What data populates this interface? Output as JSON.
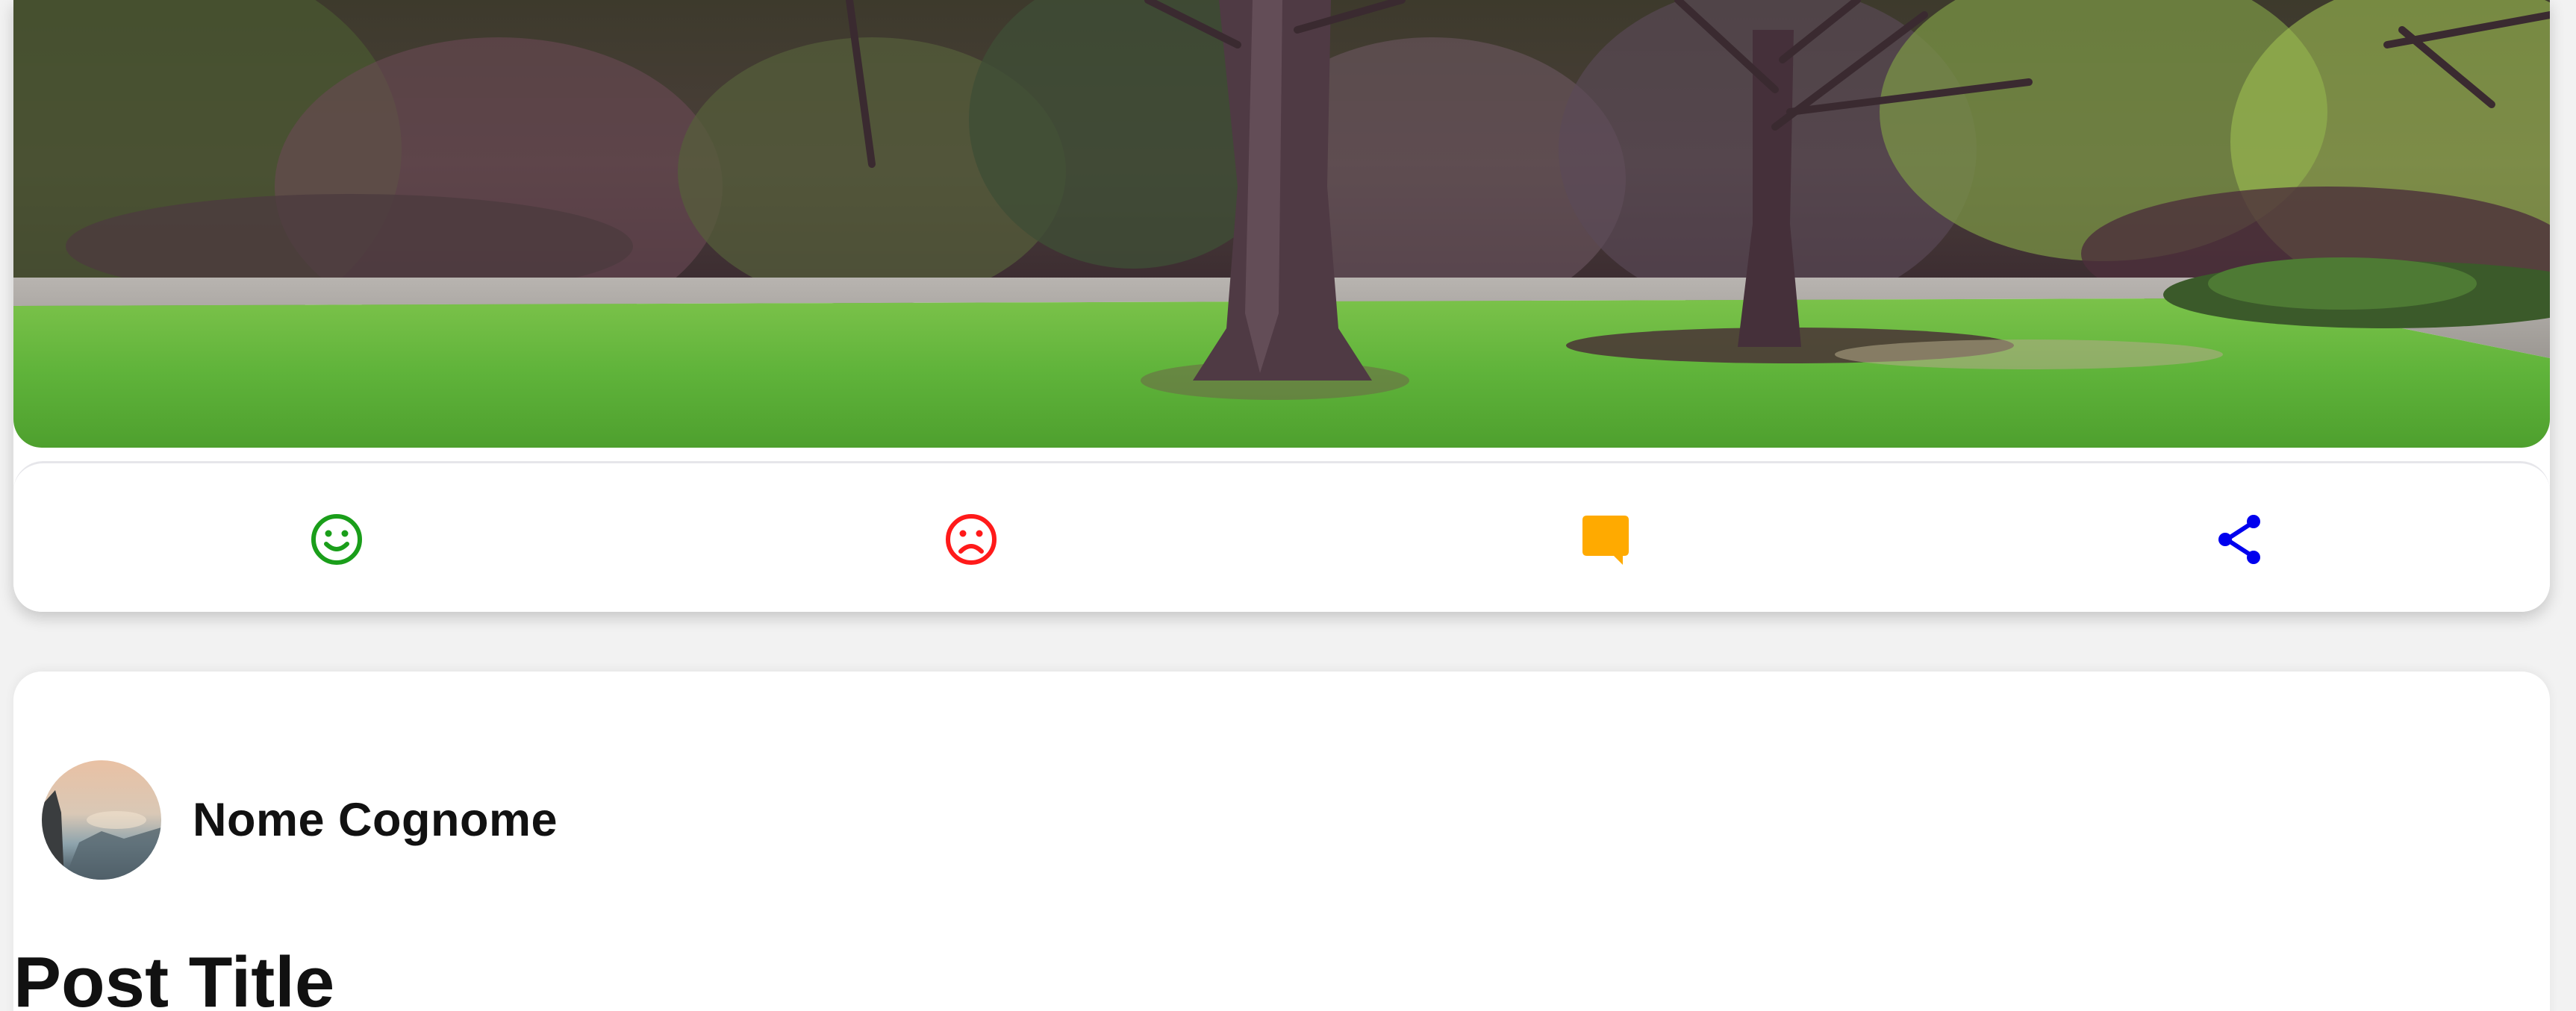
{
  "feed": {
    "photo_card": {
      "photo": "park-trees-photo",
      "actions": [
        {
          "name": "like",
          "icon": "smile-icon",
          "color": "#1a9e1a"
        },
        {
          "name": "dislike",
          "icon": "frown-icon",
          "color": "#ff1a1a"
        },
        {
          "name": "comment",
          "icon": "comment-icon",
          "color": "#ffaa00"
        },
        {
          "name": "share",
          "icon": "share-icon",
          "color": "#0000ee"
        }
      ]
    },
    "post_card": {
      "author": {
        "avatar": "avatar-landscape-photo",
        "name": "Nome Cognome"
      },
      "title": "Post Title"
    }
  }
}
